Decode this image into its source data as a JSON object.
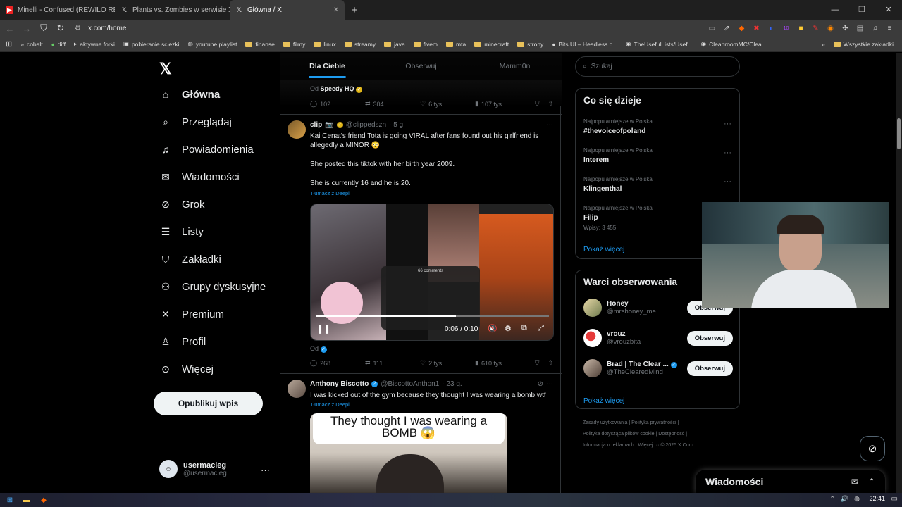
{
  "browser": {
    "tabs": [
      {
        "title": "Minelli - Confused (REWILO REMI",
        "active": false
      },
      {
        "title": "Plants vs. Zombies w serwisie X: „@P",
        "active": false
      },
      {
        "title": "Główna / X",
        "active": true
      }
    ],
    "url": "x.com/home",
    "bookmarks": [
      "cobalt",
      "diff",
      "aktywne forki",
      "pobieranie sciezki",
      "youtube playlist",
      "finanse",
      "filmy",
      "linux",
      "streamy",
      "java",
      "fivem",
      "mta",
      "minecraft",
      "strony",
      "Bits UI – Headless c...",
      "TheUsefulLists/Usef...",
      "CleanroomMC/Clea..."
    ],
    "all_bookmarks": "Wszystkie zakładki",
    "ext_badge": "10"
  },
  "nav": {
    "items": [
      "Główna",
      "Przeglądaj",
      "Powiadomienia",
      "Wiadomości",
      "Grok",
      "Listy",
      "Zakładki",
      "Grupy dyskusyjne",
      "Premium",
      "Profil",
      "Więcej"
    ],
    "post_button": "Opublikuj wpis",
    "user_name": "usermacieg",
    "user_handle": "@usermacieg"
  },
  "timeline": {
    "tabs": [
      "Dla Ciebie",
      "Obserwuj",
      "Mamm0n"
    ],
    "prev": {
      "from_label": "Od",
      "from_name": "Speedy HQ",
      "replies": "102",
      "reposts": "304",
      "likes": "6 tys.",
      "views": "107 tys."
    },
    "tweet1": {
      "name": "clip",
      "handle": "@clippedszn",
      "time": "· 5 g.",
      "line1": "Kai Cenat's friend Tota is going VIRAL after fans found out his girlfriend is allegedly a MINOR 😳",
      "line2": "She posted this tiktok with her birth year 2009.",
      "line3": "She is currently 16 and he is 20.",
      "translate": "Tłumacz z Deepl",
      "video_time": "0:06 / 0:10",
      "comments_overlay": "66 comments",
      "from_label": "Od",
      "replies": "268",
      "reposts": "111",
      "likes": "2 tys.",
      "views": "610 tys."
    },
    "tweet2": {
      "name": "Anthony Biscotto",
      "handle": "@BiscottoAnthon1",
      "time": "· 23 g.",
      "text": "I was kicked out of the gym because they thought I was wearing a bomb wtf",
      "translate": "Tłumacz z Deepl",
      "image_caption": "They thought I was wearing a BOMB 😱"
    }
  },
  "sidebar": {
    "search_placeholder": "Szukaj",
    "trends_title": "Co się dzieje",
    "trends": [
      {
        "meta": "Najpopularniejsze w Polska",
        "name": "#thevoiceofpoland",
        "count": ""
      },
      {
        "meta": "Najpopularniejsze w Polska",
        "name": "Interem",
        "count": ""
      },
      {
        "meta": "Najpopularniejsze w Polska",
        "name": "Klingenthal",
        "count": ""
      },
      {
        "meta": "Najpopularniejsze w Polska",
        "name": "Filip",
        "count": "Wpisy: 3 455"
      }
    ],
    "show_more": "Pokaż więcej",
    "who_title": "Warci obserwowania",
    "who": [
      {
        "name": "Honey",
        "handle": "@mrshoney_me"
      },
      {
        "name": "vrouz",
        "handle": "@vrouzbita"
      },
      {
        "name": "Brad | The Clear ...",
        "handle": "@TheClearedMind"
      }
    ],
    "follow_label": "Obserwuj",
    "show_more2": "Pokaż więcej",
    "footer": [
      "Zasady użytkowania",
      "Polityka prywatności",
      "Polityka dotycząca plików cookie",
      "Dostępność",
      "Informacja o reklamach",
      "Więcej ···",
      "© 2025 X Corp."
    ]
  },
  "messages_bar": "Wiadomości",
  "clock": "22:41"
}
